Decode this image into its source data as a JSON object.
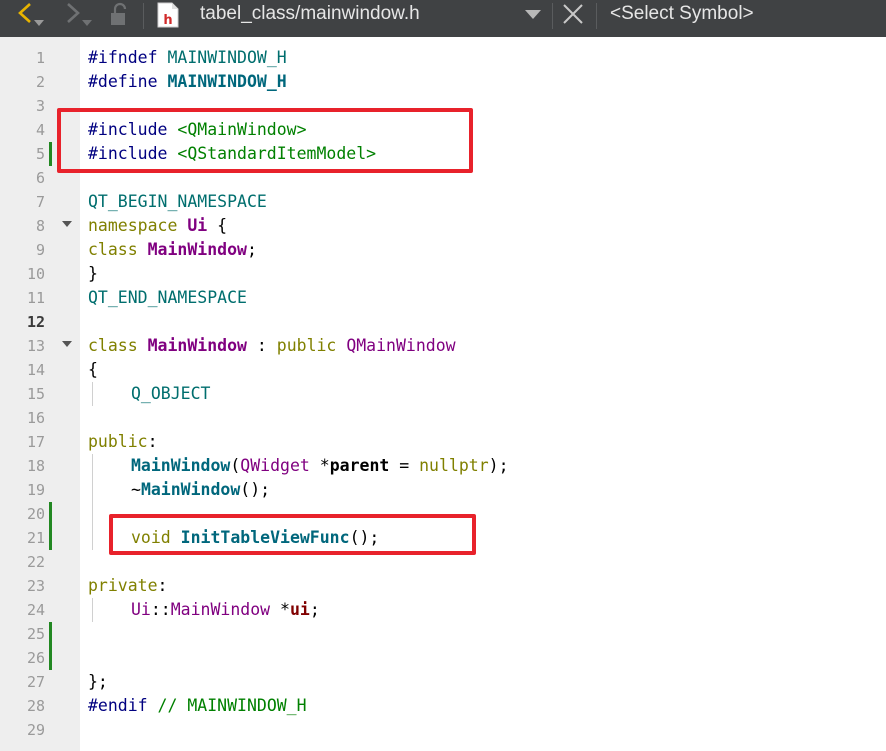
{
  "toolbar": {
    "file_title": "tabel_class/mainwindow.h",
    "symbol": "<Select Symbol>"
  },
  "lines": [
    {
      "n": "1"
    },
    {
      "n": "2"
    },
    {
      "n": "3"
    },
    {
      "n": "4"
    },
    {
      "n": "5"
    },
    {
      "n": "6"
    },
    {
      "n": "7"
    },
    {
      "n": "8"
    },
    {
      "n": "9"
    },
    {
      "n": "10"
    },
    {
      "n": "11"
    },
    {
      "n": "12"
    },
    {
      "n": "13"
    },
    {
      "n": "14"
    },
    {
      "n": "15"
    },
    {
      "n": "16"
    },
    {
      "n": "17"
    },
    {
      "n": "18"
    },
    {
      "n": "19"
    },
    {
      "n": "20"
    },
    {
      "n": "21"
    },
    {
      "n": "22"
    },
    {
      "n": "23"
    },
    {
      "n": "24"
    },
    {
      "n": "25"
    },
    {
      "n": "26"
    },
    {
      "n": "27"
    },
    {
      "n": "28"
    },
    {
      "n": "29"
    }
  ],
  "code": {
    "l1a": "#ifndef ",
    "l1b": "MAINWINDOW_H",
    "l2a": "#define ",
    "l2b": "MAINWINDOW_H",
    "l4a": "#include ",
    "l4b": "<QMainWindow>",
    "l5a": "#include ",
    "l5b": "<QStandardItemModel>",
    "l7": "QT_BEGIN_NAMESPACE",
    "l8a": "namespace ",
    "l8b": "Ui",
    "l8c": " {",
    "l9a": "class ",
    "l9b": "MainWindow",
    "l9c": ";",
    "l10": "}",
    "l11": "QT_END_NAMESPACE",
    "l13a": "class ",
    "l13b": "MainWindow",
    "l13c": " : ",
    "l13d": "public ",
    "l13e": "QMainWindow",
    "l14": "{",
    "l15": "Q_OBJECT",
    "l17a": "public",
    "l17b": ":",
    "l18a": "MainWindow",
    "l18b": "(",
    "l18c": "QWidget",
    "l18d": " *",
    "l18e": "parent",
    "l18f": " = ",
    "l18g": "nullptr",
    "l18h": ");",
    "l19a": "~",
    "l19b": "MainWindow",
    "l19c": "();",
    "l21a": "void ",
    "l21b": "InitTableViewFunc",
    "l21c": "();",
    "l23a": "private",
    "l23b": ":",
    "l24a": "Ui",
    "l24b": "::",
    "l24c": "MainWindow",
    "l24d": " *",
    "l24e": "ui",
    "l24f": ";",
    "l27": "};",
    "l28a": "#endif ",
    "l28b": "// MAINWINDOW_H"
  },
  "colors": {
    "toolbar_bg": "#404244",
    "gutter_bg": "#eeeeee",
    "change_marker": "#228822",
    "highlight_box": "#e8222b"
  },
  "icons": [
    "back-icon",
    "forward-icon",
    "lock-icon",
    "header-file-icon",
    "dropdown-icon",
    "close-icon"
  ]
}
